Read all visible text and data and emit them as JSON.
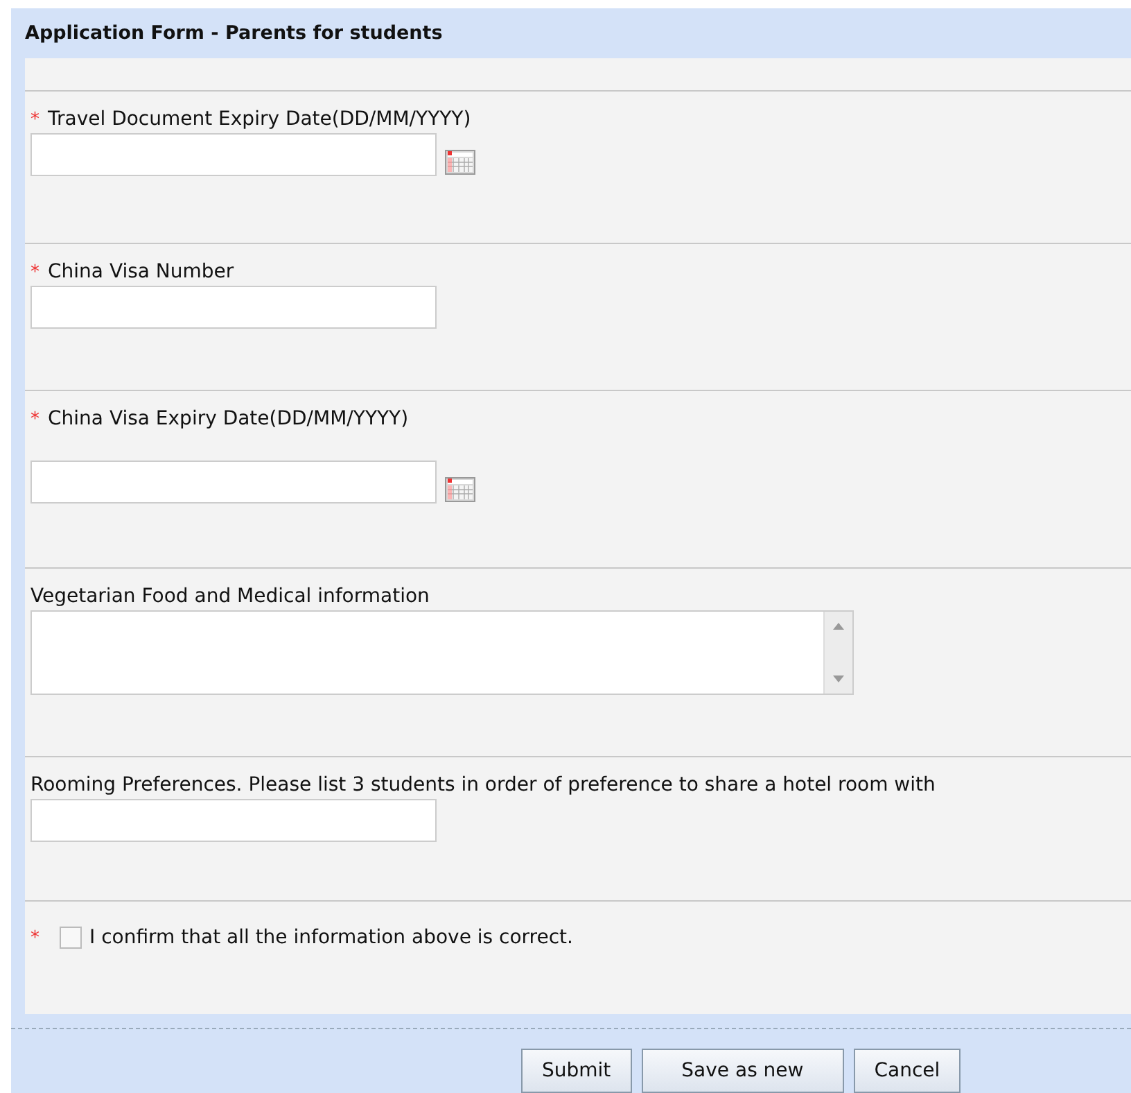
{
  "form": {
    "title": "Application Form - Parents for students"
  },
  "fields": [
    {
      "kind": "date",
      "label": "Travel Document Expiry Date(DD/MM/YYYY)",
      "required_mark": "*"
    },
    {
      "kind": "text",
      "label": "China Visa Number",
      "required_mark": "*"
    },
    {
      "kind": "date",
      "label": "China Visa Expiry Date(DD/MM/YYYY)",
      "required_mark": "*"
    },
    {
      "kind": "textarea",
      "label": "Vegetarian Food and Medical information"
    },
    {
      "kind": "text",
      "label": "Rooming Preferences. Please list 3 students in order of preference to share a hotel room with"
    },
    {
      "kind": "checkbox",
      "label": "I confirm that all the information above is correct.",
      "required_mark": "*",
      "checked": false
    }
  ],
  "buttons": [
    "Submit",
    "Save as new",
    "Cancel"
  ]
}
